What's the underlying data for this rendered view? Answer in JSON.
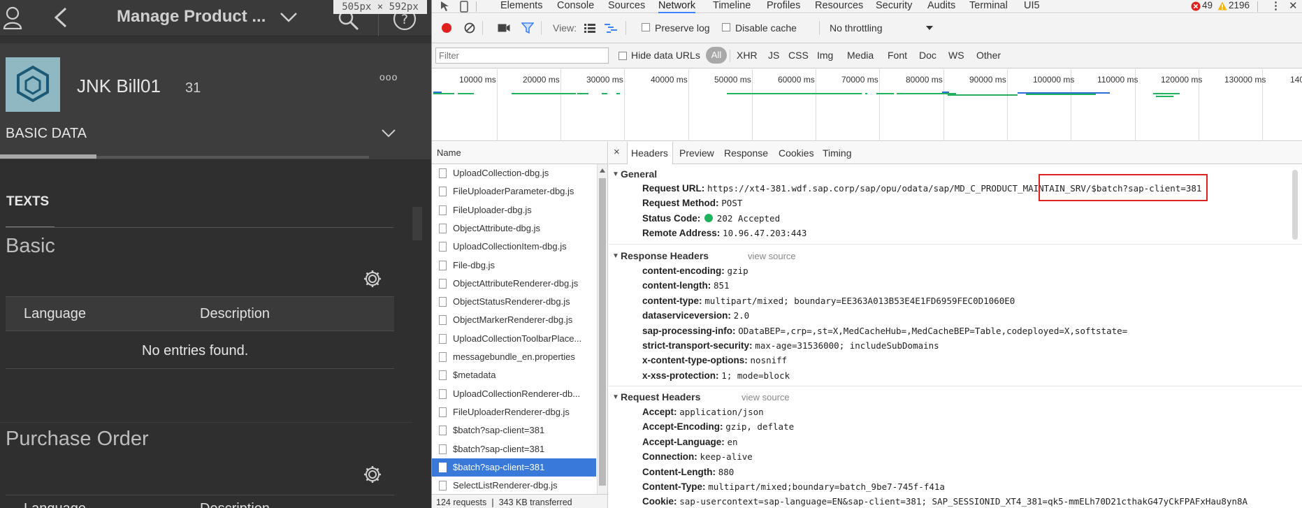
{
  "app": {
    "title": "Manage Product ...",
    "size_badge": "505px × 592px",
    "object_title": "JNK Bill01",
    "object_number": "31",
    "more_label": "ooo",
    "section_tab": "BASIC DATA",
    "subsection_tab": "TEXTS",
    "basic_title": "Basic",
    "table_col_language": "Language",
    "table_col_description": "Description",
    "no_entries": "No entries found.",
    "purchase_order_title": "Purchase Order",
    "po_col_language": "Language",
    "po_col_description": "Description"
  },
  "devtools": {
    "tabs": [
      "Elements",
      "Console",
      "Sources",
      "Network",
      "Timeline",
      "Profiles",
      "Resources",
      "Security",
      "Audits",
      "Terminal",
      "UI5"
    ],
    "active_tab": "Network",
    "error_count": "49",
    "warning_count": "2196",
    "toolbar": {
      "view_label": "View:",
      "preserve_log": "Preserve log",
      "disable_cache": "Disable cache",
      "throttling": "No throttling"
    },
    "filter": {
      "placeholder": "Filter",
      "hide_data_urls": "Hide data URLs",
      "types": [
        "All",
        "XHR",
        "JS",
        "CSS",
        "Img",
        "Media",
        "Font",
        "Doc",
        "WS",
        "Other"
      ]
    },
    "timeline_ticks": [
      "10000 ms",
      "20000 ms",
      "30000 ms",
      "40000 ms",
      "50000 ms",
      "60000 ms",
      "70000 ms",
      "80000 ms",
      "90000 ms",
      "100000 ms",
      "110000 ms",
      "120000 ms",
      "130000 ms",
      "140"
    ],
    "list": {
      "header": "Name",
      "items": [
        "UploadCollection-dbg.js",
        "FileUploaderParameter-dbg.js",
        "FileUploader-dbg.js",
        "ObjectAttribute-dbg.js",
        "UploadCollectionItem-dbg.js",
        "File-dbg.js",
        "ObjectAttributeRenderer-dbg.js",
        "ObjectStatusRenderer-dbg.js",
        "ObjectMarkerRenderer-dbg.js",
        "UploadCollectionToolbarPlace...",
        "messagebundle_en.properties",
        "$metadata",
        "UploadCollectionRenderer-db...",
        "FileUploaderRenderer-dbg.js",
        "$batch?sap-client=381",
        "$batch?sap-client=381",
        "$batch?sap-client=381",
        "SelectListRenderer-dbg.js"
      ],
      "selected_index": 16,
      "footer": "124 requests ❘ 343 KB transferred"
    },
    "detail_tabs": [
      "Headers",
      "Preview",
      "Response",
      "Cookies",
      "Timing"
    ],
    "close_label": "×",
    "general": {
      "title": "General",
      "rows": [
        {
          "k": "Request URL:",
          "v": "https://xt4-381.wdf.sap.corp/sap/opu/odata/sap/MD_C_PRODUCT_MAINTAIN_SRV/$batch?sap-client=381"
        },
        {
          "k": "Request Method:",
          "v": "POST"
        },
        {
          "k": "Status Code:",
          "v": "202 Accepted"
        },
        {
          "k": "Remote Address:",
          "v": "10.96.47.203:443"
        }
      ]
    },
    "response_headers": {
      "title": "Response Headers",
      "view_source": "view source",
      "rows": [
        {
          "k": "content-encoding:",
          "v": "gzip"
        },
        {
          "k": "content-length:",
          "v": "851"
        },
        {
          "k": "content-type:",
          "v": "multipart/mixed; boundary=EE363A013B53E4E1FD6959FEC0D1060E0"
        },
        {
          "k": "dataserviceversion:",
          "v": "2.0"
        },
        {
          "k": "sap-processing-info:",
          "v": "ODataBEP=,crp=,st=X,MedCacheHub=,MedCacheBEP=Table,codeployed=X,softstate="
        },
        {
          "k": "strict-transport-security:",
          "v": "max-age=31536000; includeSubDomains"
        },
        {
          "k": "x-content-type-options:",
          "v": "nosniff"
        },
        {
          "k": "x-xss-protection:",
          "v": "1; mode=block"
        }
      ]
    },
    "request_headers": {
      "title": "Request Headers",
      "view_source": "view source",
      "rows": [
        {
          "k": "Accept:",
          "v": "application/json"
        },
        {
          "k": "Accept-Encoding:",
          "v": "gzip, deflate"
        },
        {
          "k": "Accept-Language:",
          "v": "en"
        },
        {
          "k": "Connection:",
          "v": "keep-alive"
        },
        {
          "k": "Content-Length:",
          "v": "880"
        },
        {
          "k": "Content-Type:",
          "v": "multipart/mixed;boundary=batch_9be7-745f-f41a"
        },
        {
          "k": "Cookie:",
          "v": "sap-usercontext=sap-language=EN&sap-client=381; SAP_SESSIONID_XT4_381=qk5-mmELh70D21cthakG47yCkFPAFxHau8yn8A"
        }
      ]
    },
    "colors": {
      "accent": "#3e82f7",
      "selected_row": "#3879d9",
      "status_ok": "#20b25c",
      "highlight_box": "#e0201c",
      "record": "#e0201c"
    }
  }
}
